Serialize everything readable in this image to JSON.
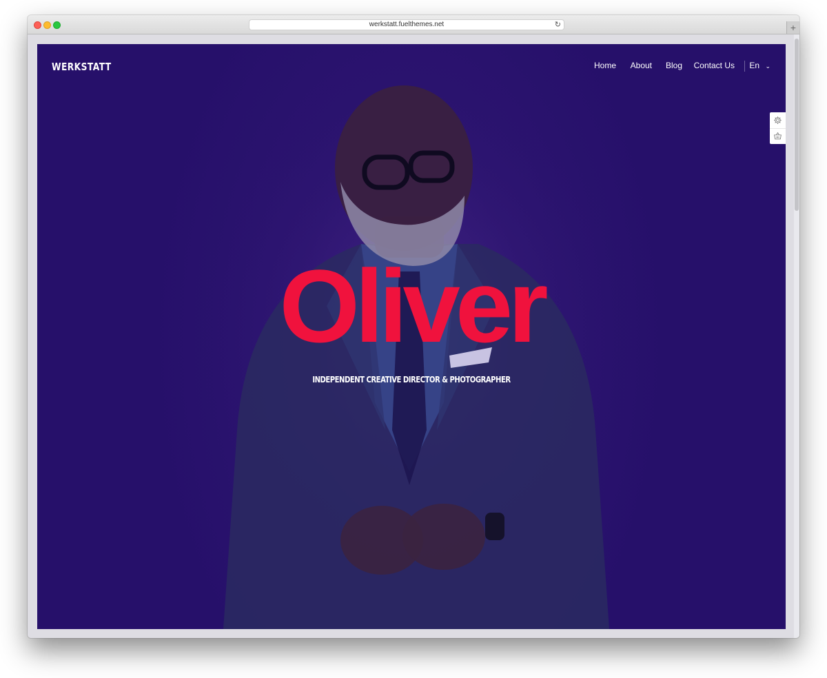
{
  "browser": {
    "url": "werkstatt.fuelthemes.net",
    "reload_icon": "reload-icon",
    "new_tab_icon": "plus-icon"
  },
  "site": {
    "logo": "WERKSTATT",
    "nav": {
      "items": [
        "Home",
        "About",
        "Blog",
        "Contact Us"
      ],
      "language": "En",
      "language_icon": "chevron-down-icon"
    },
    "side_tools": [
      "gear-icon",
      "basket-icon"
    ],
    "hero": {
      "title": "Oliver",
      "subtitle": "INDEPENDENT CREATIVE DIRECTOR & PHOTOGRAPHER"
    }
  },
  "colors": {
    "hero_background": "#2a136f",
    "title": "#f0123d",
    "text": "#ffffff"
  }
}
